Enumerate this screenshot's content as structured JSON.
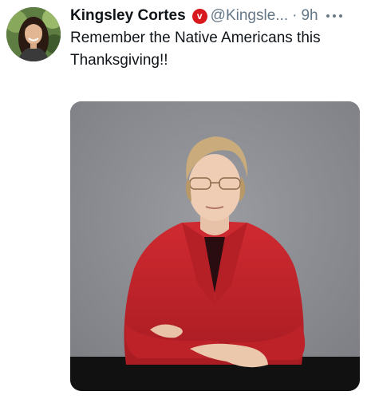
{
  "tweet": {
    "display_name": "Kingsley Cortes",
    "badge_letter": "v",
    "handle": "@Kingsle...",
    "separator": "·",
    "timestamp": "9h",
    "text_line1": "Remember the Native Americans this",
    "text_line2": "Thanksgiving!!"
  },
  "icons": {
    "verified": "verified-badge-icon",
    "more": "more-options-icon"
  },
  "colors": {
    "badge": "#d7191e",
    "secondary_text": "#657786",
    "jacket": "#c8242c",
    "backdrop": "#8d8f94"
  }
}
